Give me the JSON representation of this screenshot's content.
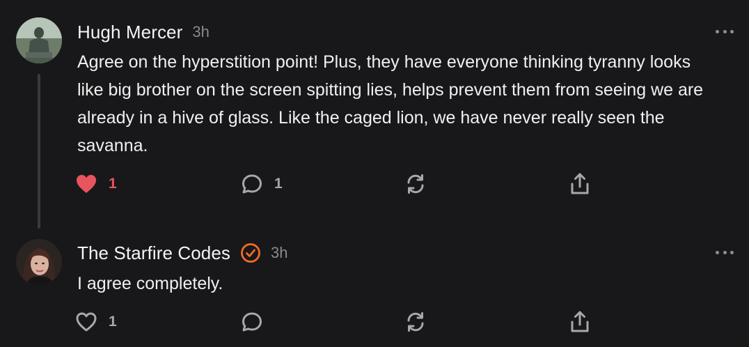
{
  "comments": [
    {
      "author": "Hugh Mercer",
      "time": "3h",
      "verified": false,
      "avatar": "statue-photo",
      "text": "Agree on the hyperstition point! Plus, they have everyone thinking tyranny looks like big brother on the screen spitting lies, helps prevent them from seeing we are already in a hive of glass. Like the caged lion, we have never really seen the savanna.",
      "likes": "1",
      "liked": true,
      "replies": "1"
    },
    {
      "author": "The Starfire Codes",
      "time": "3h",
      "verified": true,
      "avatar": "woman-photo",
      "text": "I agree completely.",
      "likes": "1",
      "liked": false,
      "replies": ""
    }
  ],
  "icons": {
    "like": "heart-icon",
    "reply": "comment-bubble-icon",
    "restack": "restack-icon",
    "share": "share-icon",
    "more": "more-dots-icon",
    "verified": "verified-badge-icon"
  },
  "colors": {
    "background": "#18181a",
    "liked": "#e8555e",
    "verified": "#f26b25",
    "muted": "#8a8a8e"
  }
}
